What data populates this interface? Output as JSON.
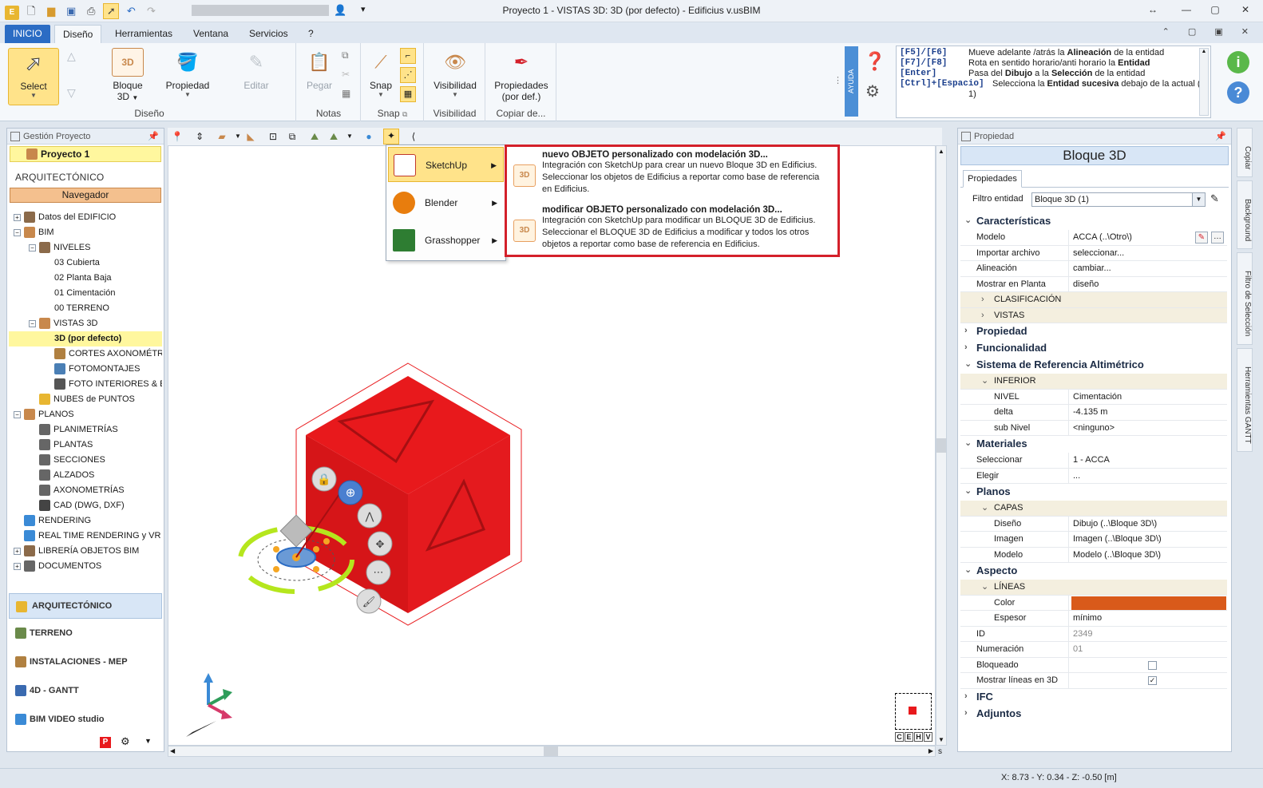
{
  "window": {
    "title": "Proyecto 1 -  VISTAS 3D: 3D (por defecto) - Edificius v.usBIM"
  },
  "ribbon_tabs": [
    "INICIO",
    "Diseño",
    "Herramientas",
    "Ventana",
    "Servicios",
    "?"
  ],
  "ribbon": {
    "select_label": "Select",
    "bloque_label": "Bloque",
    "bloque_sub": "3D",
    "propiedad_label": "Propiedad",
    "editar_label": "Editar",
    "pegar_label": "Pegar",
    "snap_label": "Snap",
    "visibilidad_label": "Visibilidad",
    "propiedades_label": "Propiedades",
    "propiedades_sub": "(por def.)",
    "groups": {
      "diseno": "Diseño",
      "notas": "Notas",
      "snap": "Snap",
      "visibilidad": "Visibilidad",
      "copiar": "Copiar de..."
    },
    "ayuda": "AYUDA"
  },
  "help": [
    {
      "key": "[F5]/[F6]",
      "pre": "Mueve adelante /atrás la ",
      "bold": "Alineación",
      "post": " de la entidad"
    },
    {
      "key": "[F7]/[F8]",
      "pre": "Rota en sentido horario/anti horario la ",
      "bold": "Entidad",
      "post": ""
    },
    {
      "key": "[Enter]",
      "pre": "Pasa del ",
      "bold": "Dibujo",
      "mid": " a la ",
      "bold2": "Selección",
      "post": " de la entidad"
    },
    {
      "key": "[Ctrl]+[Espacio]",
      "pre": "Selecciona la ",
      "bold": "Entidad sucesiva",
      "post": " debajo de la actual (*"
    },
    {
      "key": "",
      "pre": "1)",
      "bold": "",
      "post": ""
    }
  ],
  "left_panel": {
    "header": "Gestión Proyecto",
    "project": "Proyecto 1",
    "section": "ARQUITECTÓNICO",
    "navigator": "Navegador",
    "tree": [
      {
        "label": "Datos del EDIFICIO",
        "level": 0,
        "toggle": "+",
        "color": "#8b6a4a"
      },
      {
        "label": "BIM",
        "level": 0,
        "toggle": "−",
        "color": "#c8884c"
      },
      {
        "label": "NIVELES",
        "level": 1,
        "toggle": "−",
        "color": "#8b6a4a"
      },
      {
        "label": "03 Cubierta",
        "level": 2,
        "toggle": "",
        "color": ""
      },
      {
        "label": "02 Planta Baja",
        "level": 2,
        "toggle": "",
        "color": ""
      },
      {
        "label": "01 Cimentación",
        "level": 2,
        "toggle": "",
        "color": ""
      },
      {
        "label": "00 TERRENO",
        "level": 2,
        "toggle": "",
        "color": ""
      },
      {
        "label": "VISTAS 3D",
        "level": 1,
        "toggle": "−",
        "color": "#c8884c"
      },
      {
        "label": "3D (por defecto)",
        "level": 2,
        "toggle": "",
        "color": "",
        "highlight": true
      },
      {
        "label": "CORTES AXONOMÉTRICOS",
        "level": 2,
        "toggle": "",
        "color": "#b08040"
      },
      {
        "label": "FOTOMONTAJES",
        "level": 2,
        "toggle": "",
        "color": "#4a7fb5"
      },
      {
        "label": "FOTO INTERIORES & EXTERIORES",
        "level": 2,
        "toggle": "",
        "color": "#555"
      },
      {
        "label": "NUBES de PUNTOS",
        "level": 1,
        "toggle": "",
        "color": "#e8b631"
      },
      {
        "label": "PLANOS",
        "level": 0,
        "toggle": "−",
        "color": "#c8884c"
      },
      {
        "label": "PLANIMETRÍAS",
        "level": 1,
        "toggle": "",
        "color": "#666"
      },
      {
        "label": "PLANTAS",
        "level": 1,
        "toggle": "",
        "color": "#666"
      },
      {
        "label": "SECCIONES",
        "level": 1,
        "toggle": "",
        "color": "#666"
      },
      {
        "label": "ALZADOS",
        "level": 1,
        "toggle": "",
        "color": "#666"
      },
      {
        "label": "AXONOMETRÍAS",
        "level": 1,
        "toggle": "",
        "color": "#666"
      },
      {
        "label": "CAD (DWG, DXF)",
        "level": 1,
        "toggle": "",
        "color": "#444"
      },
      {
        "label": "RENDERING",
        "level": 0,
        "toggle": "",
        "color": "#3a8ad6"
      },
      {
        "label": "REAL TIME RENDERING y VR",
        "level": 0,
        "toggle": "",
        "color": "#3a8ad6"
      },
      {
        "label": "LIBRERÍA OBJETOS BIM",
        "level": 0,
        "toggle": "+",
        "color": "#8b6a4a"
      },
      {
        "label": "DOCUMENTOS",
        "level": 0,
        "toggle": "+",
        "color": "#666"
      }
    ],
    "bottom_tabs": [
      {
        "label": "ARQUITECTÓNICO",
        "active": true,
        "color": "#e8b631"
      },
      {
        "label": "TERRENO",
        "active": false,
        "color": "#6a8a4a"
      },
      {
        "label": "INSTALACIONES - MEP",
        "active": false,
        "color": "#b08040"
      },
      {
        "label": "4D - GANTT",
        "active": false,
        "color": "#3a6ab0"
      },
      {
        "label": "BIM VIDEO studio",
        "active": false,
        "color": "#3a8ad6"
      }
    ]
  },
  "plugin_menu": [
    {
      "label": "SketchUp",
      "hover": true,
      "icon": "sketchup-icon",
      "color": "#c0392b"
    },
    {
      "label": "Blender",
      "hover": false,
      "icon": "blender-icon",
      "color": "#e87d0d"
    },
    {
      "label": "Grasshopper",
      "hover": false,
      "icon": "grasshopper-icon",
      "color": "#2e7d32"
    }
  ],
  "submenu": [
    {
      "title": "nuevo OBJETO personalizado con modelación 3D...",
      "lines": [
        "Integración con SketchUp para crear un nuevo Bloque 3D en Edificius.",
        "Seleccionar los objetos de Edificius a reportar como base de referencia",
        "en Edificius."
      ]
    },
    {
      "title": "modificar OBJETO personalizado con modelación 3D...",
      "lines": [
        "Integración con SketchUp para modificar un BLOQUE 3D de Edificius.",
        "Seleccionar el BLOQUE 3D de Edificius a modificar y todos los otros",
        "objetos a reportar como base de referencia en Edificius."
      ]
    }
  ],
  "view_cube": [
    "C",
    "E",
    "H",
    "V"
  ],
  "properties": {
    "header": "Propiedad",
    "title": "Bloque 3D",
    "tab": "Propiedades",
    "filter_label": "Filtro entidad",
    "filter_value": "Bloque 3D (1)",
    "rows": [
      {
        "type": "cat",
        "exp": "v",
        "k": "Características"
      },
      {
        "type": "row",
        "k": "Modelo",
        "v": "ACCA   (..\\Otro\\)"
      },
      {
        "type": "row",
        "k": "Importar archivo",
        "v": "seleccionar..."
      },
      {
        "type": "row",
        "k": "Alineación",
        "v": "cambiar..."
      },
      {
        "type": "row",
        "k": "Mostrar en Planta",
        "v": "diseño"
      },
      {
        "type": "sub",
        "exp": ">",
        "k": "CLASIFICACIÓN"
      },
      {
        "type": "sub",
        "exp": ">",
        "k": "VISTAS"
      },
      {
        "type": "cat",
        "exp": ">",
        "k": "Propiedad"
      },
      {
        "type": "cat",
        "exp": ">",
        "k": "Funcionalidad"
      },
      {
        "type": "cat",
        "exp": "v",
        "k": "Sistema de Referencia Altimétrico"
      },
      {
        "type": "sub",
        "exp": "v",
        "k": "INFERIOR"
      },
      {
        "type": "deep",
        "k": "NIVEL",
        "v": "Cimentación"
      },
      {
        "type": "deep",
        "k": "delta",
        "v": "-4.135 m"
      },
      {
        "type": "deep",
        "k": "sub Nivel",
        "v": "<ninguno>"
      },
      {
        "type": "cat",
        "exp": "v",
        "k": "Materiales"
      },
      {
        "type": "row",
        "k": "Seleccionar",
        "v": "1 - ACCA"
      },
      {
        "type": "row",
        "k": "Elegir",
        "v": "..."
      },
      {
        "type": "cat",
        "exp": "v",
        "k": "Planos"
      },
      {
        "type": "sub",
        "exp": "v",
        "k": "CAPAS"
      },
      {
        "type": "deep",
        "k": "Diseño",
        "v": "Dibujo   (..\\Bloque 3D\\)"
      },
      {
        "type": "deep",
        "k": "Imagen",
        "v": "Imagen   (..\\Bloque 3D\\)"
      },
      {
        "type": "deep",
        "k": "Modelo",
        "v": "Modelo   (..\\Bloque 3D\\)"
      },
      {
        "type": "cat",
        "exp": "v",
        "k": "Aspecto"
      },
      {
        "type": "sub",
        "exp": "v",
        "k": "LÍNEAS"
      },
      {
        "type": "deep",
        "k": "Color",
        "v": "",
        "color": "#d95a1a"
      },
      {
        "type": "deep",
        "k": "Espesor",
        "v": "mínimo"
      },
      {
        "type": "muted",
        "k": "ID",
        "v": "2349"
      },
      {
        "type": "muted",
        "k": "Numeración",
        "v": "01"
      },
      {
        "type": "check",
        "k": "Bloqueado",
        "checked": false
      },
      {
        "type": "check",
        "k": "Mostrar líneas en 3D",
        "checked": true
      },
      {
        "type": "cat",
        "exp": ">",
        "k": "IFC"
      },
      {
        "type": "cat",
        "exp": ">",
        "k": "Adjuntos"
      }
    ]
  },
  "right_strip": [
    "Copiar",
    "Background",
    "Filtro de Selección",
    "Herramientas GANTT"
  ],
  "status": {
    "coords": "X: 8.73 - Y: 0.34 - Z: -0.50 [m]"
  },
  "colors": {
    "block_red": "#e8191c",
    "accent_blue": "#2b6cc4",
    "highlight_yellow": "#fff79e",
    "submenu_border": "#d4202a"
  }
}
